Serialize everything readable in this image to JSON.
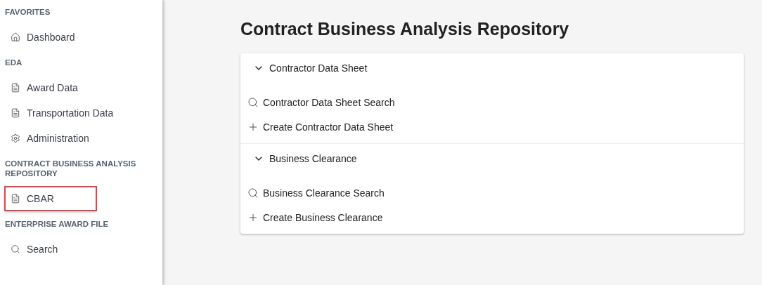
{
  "sidebar": {
    "sections": [
      {
        "heading": "FAVORITES",
        "items": [
          {
            "label": "Dashboard",
            "kind": "home",
            "highlighted": false
          }
        ]
      },
      {
        "heading": "EDA",
        "items": [
          {
            "label": "Award Data",
            "kind": "document",
            "highlighted": false
          },
          {
            "label": "Transportation Data",
            "kind": "document",
            "highlighted": false
          },
          {
            "label": "Administration",
            "kind": "settings",
            "highlighted": false
          }
        ]
      },
      {
        "heading": "CONTRACT BUSINESS ANALYSIS REPOSITORY",
        "items": [
          {
            "label": "CBAR",
            "kind": "document",
            "highlighted": true
          }
        ]
      },
      {
        "heading": "ENTERPRISE AWARD FILE",
        "items": [
          {
            "label": "Search",
            "kind": "search",
            "highlighted": false
          }
        ]
      }
    ]
  },
  "main": {
    "title": "Contract Business Analysis Repository",
    "panels": [
      {
        "title": "Contractor Data Sheet",
        "expanded": true,
        "actions": [
          {
            "label": "Contractor Data Sheet Search",
            "kind": "search"
          },
          {
            "label": "Create Contractor Data Sheet",
            "kind": "create"
          }
        ]
      },
      {
        "title": "Business Clearance",
        "expanded": true,
        "actions": [
          {
            "label": "Business Clearance Search",
            "kind": "search"
          },
          {
            "label": "Create Business Clearance",
            "kind": "create"
          }
        ]
      }
    ]
  }
}
